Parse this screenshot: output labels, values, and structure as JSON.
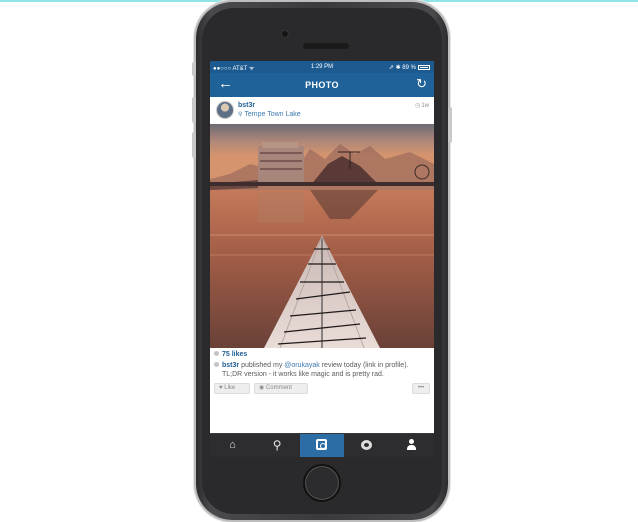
{
  "status_bar": {
    "carrier": "●●○○○ AT&T ᯤ",
    "time": "1:29 PM",
    "right": "⇗ ✱ 89 %"
  },
  "nav": {
    "back_icon": "arrow-left-icon",
    "title": "PHOTO",
    "refresh_icon": "refresh-icon"
  },
  "post": {
    "username": "bst3r",
    "location": "Tempe Town Lake",
    "time_ago": "1w",
    "likes": "75 likes",
    "caption_user": "bst3r",
    "caption_pre": " published my ",
    "caption_mention": "@orukayak",
    "caption_post": " review today (link in profile).",
    "caption_line2": "TL;DR version - it works like magic and is pretty rad."
  },
  "actions": {
    "like_label": "Like",
    "comment_label": "Comment",
    "more_label": "•••"
  },
  "tabs": [
    {
      "name": "home",
      "icon": "home-icon"
    },
    {
      "name": "explore",
      "icon": "search-icon"
    },
    {
      "name": "camera",
      "icon": "camera-icon",
      "active": true
    },
    {
      "name": "activity",
      "icon": "chat-bubble-icon"
    },
    {
      "name": "profile",
      "icon": "person-icon"
    }
  ],
  "colors": {
    "nav_blue": "#1f6299",
    "status_blue": "#1c5a90",
    "link_blue": "#1f5d94",
    "tab_dark": "#2d2d30",
    "tab_active": "#2d6da5"
  }
}
